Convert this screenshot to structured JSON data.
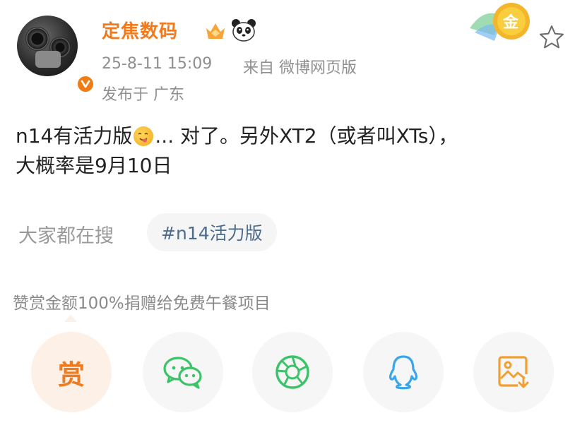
{
  "user": {
    "name": "定焦数码",
    "time": "25-8-11 15:09",
    "source": "来自 微博网页版",
    "location": "发布于 广东"
  },
  "medal": {
    "label": "金"
  },
  "post": {
    "text_part1": "n14有活力版",
    "text_part2": "... 对了。另外XT2（或者叫XTs），",
    "text_part3": "大概率是9月10日"
  },
  "search": {
    "label": "大家都在搜",
    "hashtag": "#n14活力版"
  },
  "reward": {
    "note": "赞赏金额100%捐赠给免费午餐项目",
    "button_label": "赏"
  },
  "share_icons": [
    "wechat-icon",
    "moments-icon",
    "qq-icon",
    "save-image-icon"
  ],
  "colors": {
    "brand_orange": "#f07b1f",
    "wechat_green": "#3cc36a",
    "qq_blue": "#3aa6e8",
    "save_orange": "#f0a030",
    "hashtag_blue": "#4d6c8c"
  }
}
